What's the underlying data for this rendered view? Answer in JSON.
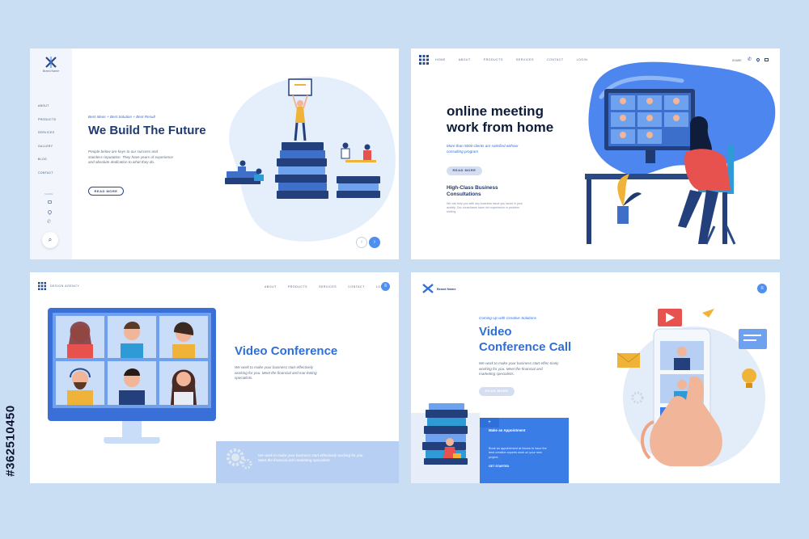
{
  "watermark": {
    "id": "#362510450"
  },
  "panel1": {
    "brand": "Brand Name",
    "nav": [
      "ABOUT",
      "PRODUCTS",
      "SERVICES",
      "GALLERY",
      "BLOG",
      "CONTACT"
    ],
    "share": "SHARE",
    "tagline": "Best Ideas + Best Solution + Best Result",
    "title": "We Build The Future",
    "body": "People below are keys to our success and stainless reputation. They have years of experience and absolute dedication to what they do.",
    "button": "READ MORE"
  },
  "panel2": {
    "nav": [
      "HOME",
      "ABOUT",
      "PRODUCTS",
      "SERVICES",
      "CONTACT",
      "LOGIN"
    ],
    "share": "SHARE",
    "title_line1": "online meeting",
    "title_line2": "work from home",
    "subtitle": "More than 5000 clients are satisfied withour consulting program",
    "button": "READ MORE",
    "section_title": "High-Class Business Consultations",
    "section_body": "We can help you with any business issue you faced in your activity. Our consultants have rich experience in problem solving."
  },
  "panel3": {
    "brand": "DESIGN AGENCY",
    "nav": [
      "ABOUT",
      "PRODUCTS",
      "SERVICES",
      "CONTACT",
      "LOGIN"
    ],
    "title": "Video Conference",
    "body": "We work to make your business start effectively working for you. Meet the financial and mar-keting specialists.",
    "footer_text": "We work to make your business start effectively working for you. Meet the financial and marketing specialists."
  },
  "panel4": {
    "brand": "Brand Name",
    "eyebrow": "Coming Up with Creative Solutions",
    "title_line1": "Video",
    "title_line2": "Conference Call",
    "body": "We work to make your business start effec-tively working for you. Meet the financial and marketing specialists.",
    "button": "READ MORE",
    "card_title": "Make an Appointment",
    "card_body": "Book an appointment at Noxes to have the best creative experts work on your new project.",
    "card_link": "GET STARTED"
  }
}
